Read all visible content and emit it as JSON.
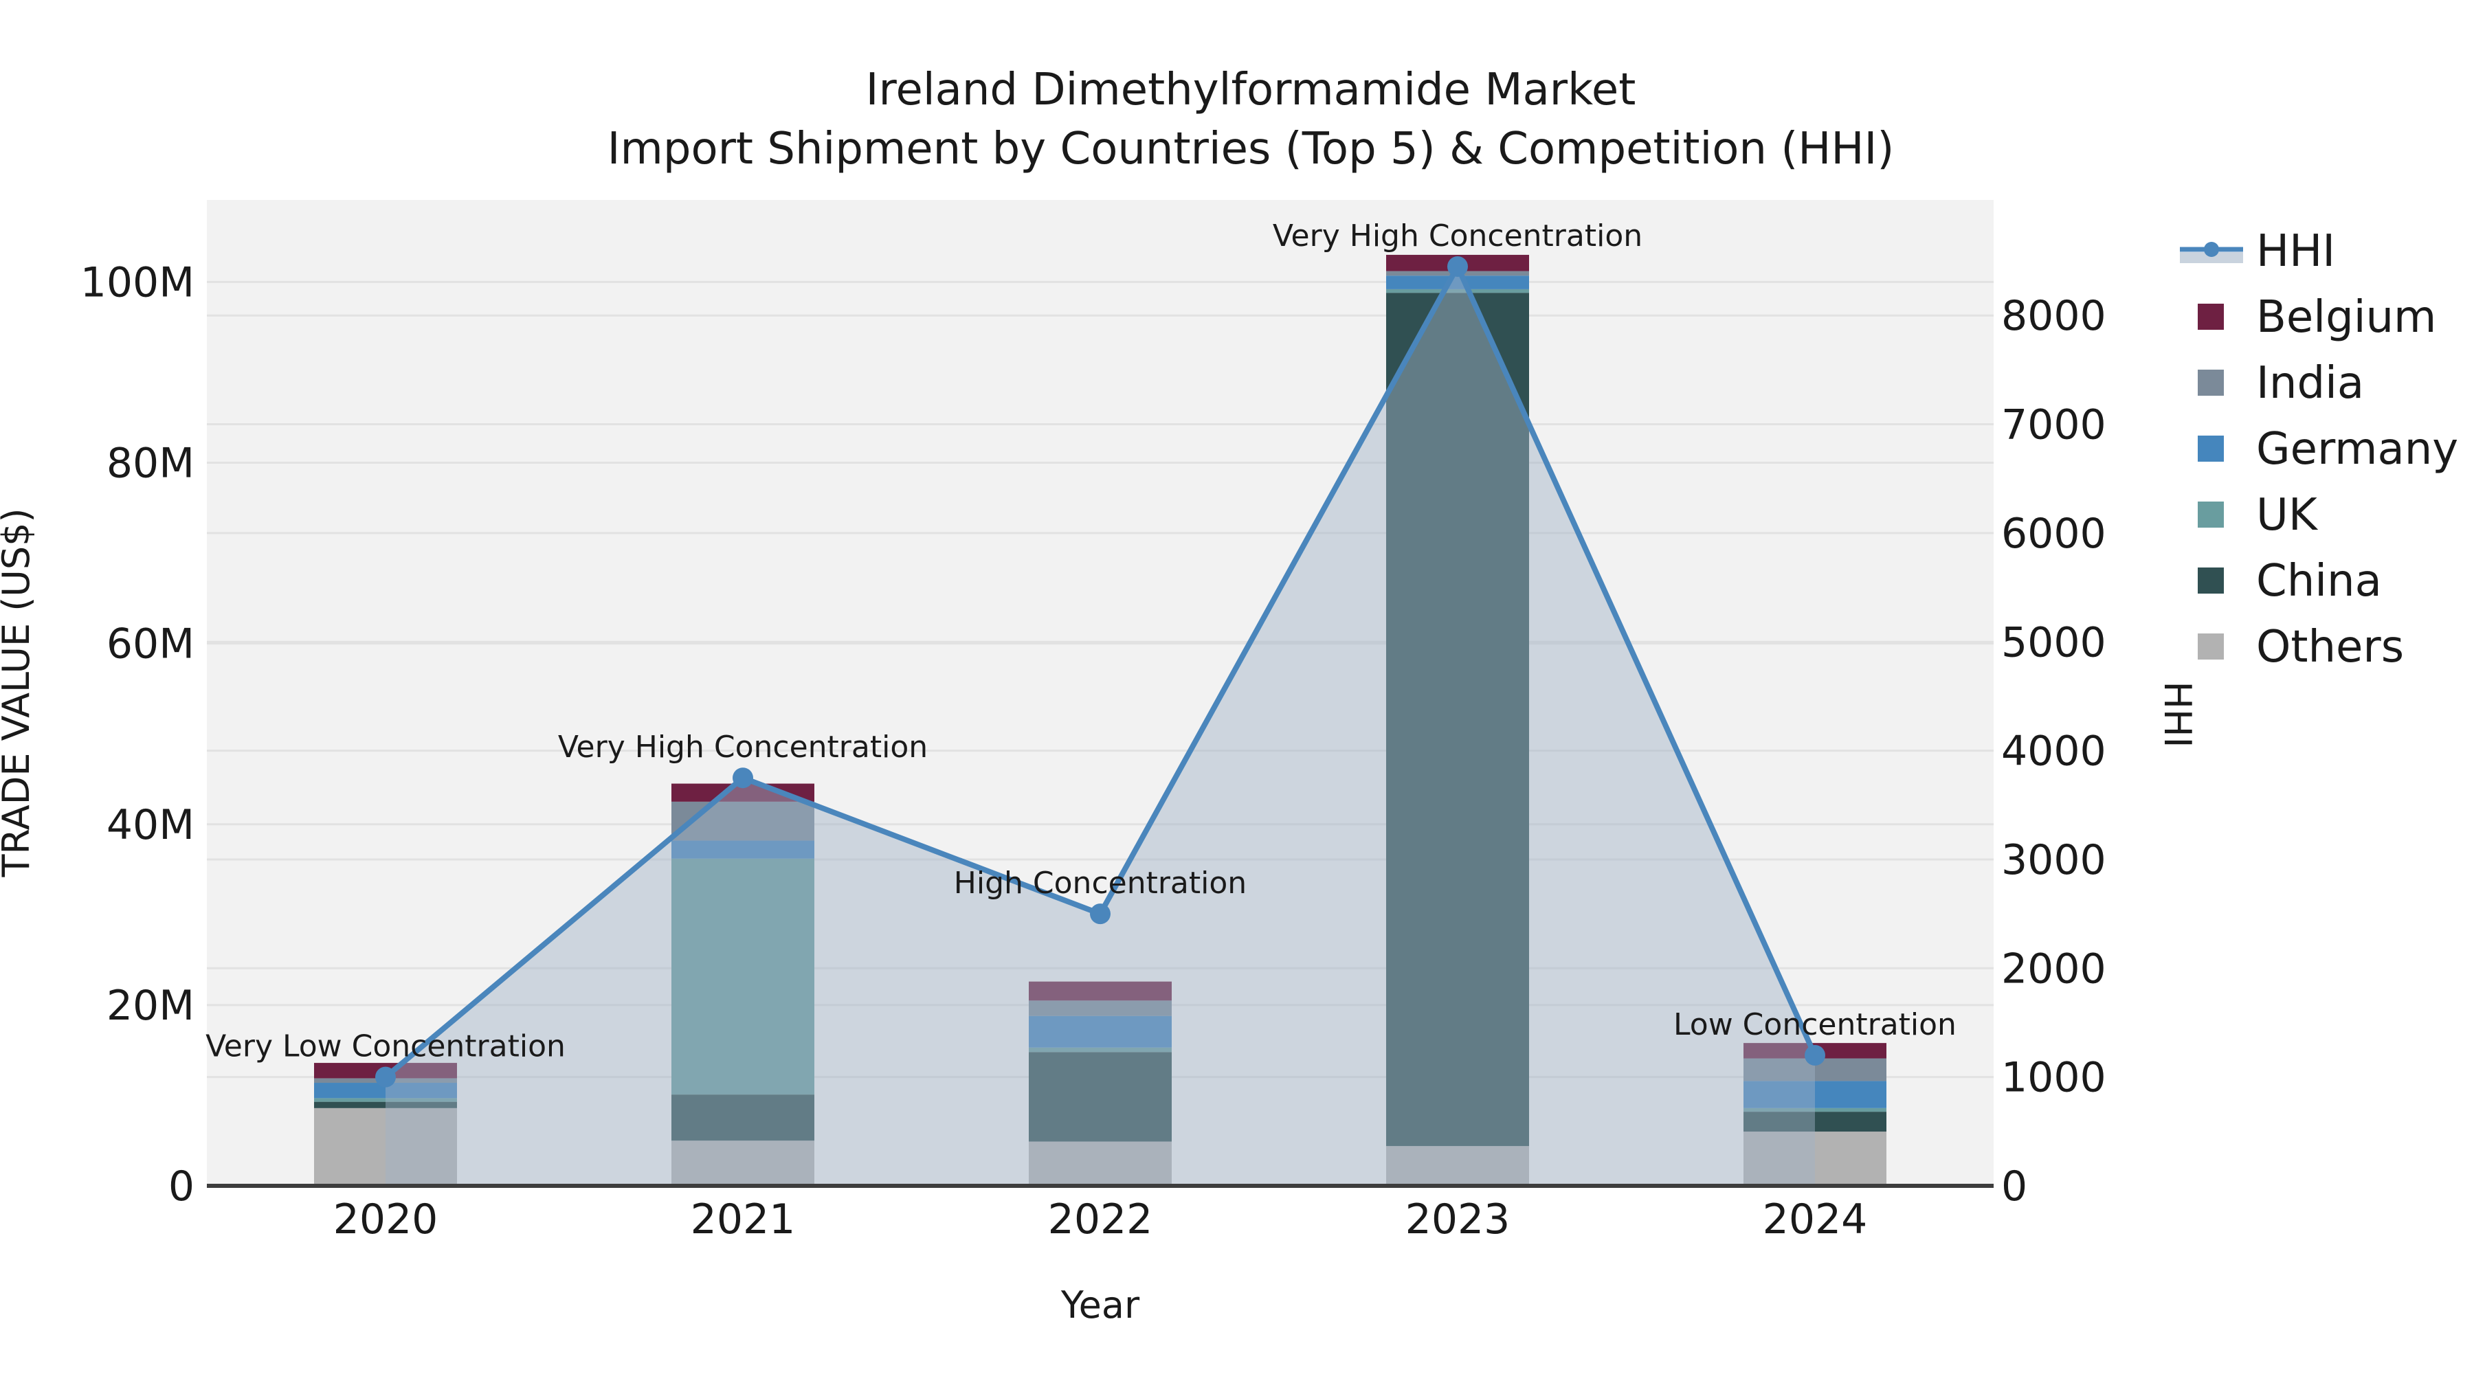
{
  "title": {
    "line1": "Ireland Dimethylformamide Market",
    "line2": "Import Shipment by Countries (Top 5) & Competition (HHI)"
  },
  "axes": {
    "x_title": "Year",
    "y_left_title": "TRADE VALUE (US$)",
    "y_right_title": "HHI",
    "y_left_tick_labels": [
      "0",
      "20M",
      "40M",
      "60M",
      "80M",
      "100M"
    ],
    "y_left_tick_values": [
      0,
      20,
      40,
      60,
      80,
      100
    ],
    "y_right_tick_labels": [
      "0",
      "1000",
      "2000",
      "3000",
      "4000",
      "5000",
      "6000",
      "7000",
      "8000"
    ],
    "y_right_tick_values": [
      0,
      1000,
      2000,
      3000,
      4000,
      5000,
      6000,
      7000,
      8000
    ]
  },
  "legend": {
    "items": [
      {
        "label": "HHI",
        "type": "line",
        "color": "#4a86bc",
        "band_color": "#c9d3de"
      },
      {
        "label": "Belgium",
        "type": "box",
        "color": "#6e2042"
      },
      {
        "label": "India",
        "type": "box",
        "color": "#7b8a99"
      },
      {
        "label": "Germany",
        "type": "box",
        "color": "#4586bd"
      },
      {
        "label": "UK",
        "type": "box",
        "color": "#699d9f"
      },
      {
        "label": "China",
        "type": "box",
        "color": "#305052"
      },
      {
        "label": "Others",
        "type": "box",
        "color": "#b2b2b2"
      }
    ]
  },
  "chart_data": {
    "type": "bar+line",
    "title": "Ireland Dimethylformamide Market — Import Shipment by Countries (Top 5) & Competition (HHI)",
    "categories": [
      "2020",
      "2021",
      "2022",
      "2023",
      "2024"
    ],
    "bar_value_unit": "million US$",
    "stack_order_bottom_to_top": [
      "Others",
      "China",
      "UK",
      "Germany",
      "India",
      "Belgium"
    ],
    "series": [
      {
        "name": "Others",
        "color": "#b2b2b2",
        "values": [
          8.6,
          5.0,
          4.9,
          4.4,
          6.0
        ]
      },
      {
        "name": "China",
        "color": "#305052",
        "values": [
          0.7,
          5.1,
          9.9,
          94.4,
          2.2
        ]
      },
      {
        "name": "UK",
        "color": "#699d9f",
        "values": [
          0.4,
          26.1,
          0.5,
          0.4,
          0.4
        ]
      },
      {
        "name": "Germany",
        "color": "#4586bd",
        "values": [
          1.7,
          2.0,
          3.5,
          1.5,
          3.0
        ]
      },
      {
        "name": "India",
        "color": "#7b8a99",
        "values": [
          0.5,
          4.3,
          1.7,
          0.5,
          2.5
        ]
      },
      {
        "name": "Belgium",
        "color": "#6e2042",
        "values": [
          1.7,
          2.0,
          2.1,
          1.8,
          1.7
        ]
      }
    ],
    "bar_totals": [
      13.6,
      44.5,
      22.6,
      103.0,
      15.8
    ],
    "line": {
      "name": "HHI",
      "color": "#4a86bc",
      "area_fill": "rgba(160,178,197,0.45)",
      "values": [
        1000,
        3750,
        2500,
        8450,
        1200
      ]
    },
    "annotations": [
      "Very Low Concentration",
      "Very High Concentration",
      "High Concentration",
      "Very High Concentration",
      "Low Concentration"
    ],
    "xlabel": "Year",
    "ylabel_left": "TRADE VALUE (US$)",
    "ylabel_right": "HHI",
    "y_left_range_M": [
      0,
      109
    ],
    "y_right_range": [
      0,
      9060
    ],
    "grid": true,
    "legend_position": "right"
  },
  "colors": {
    "plot_background": "#f2f2f2",
    "gridline": "#e2e2e2",
    "axis_line": "#3d3d3d",
    "text": "#1a1a1a"
  }
}
